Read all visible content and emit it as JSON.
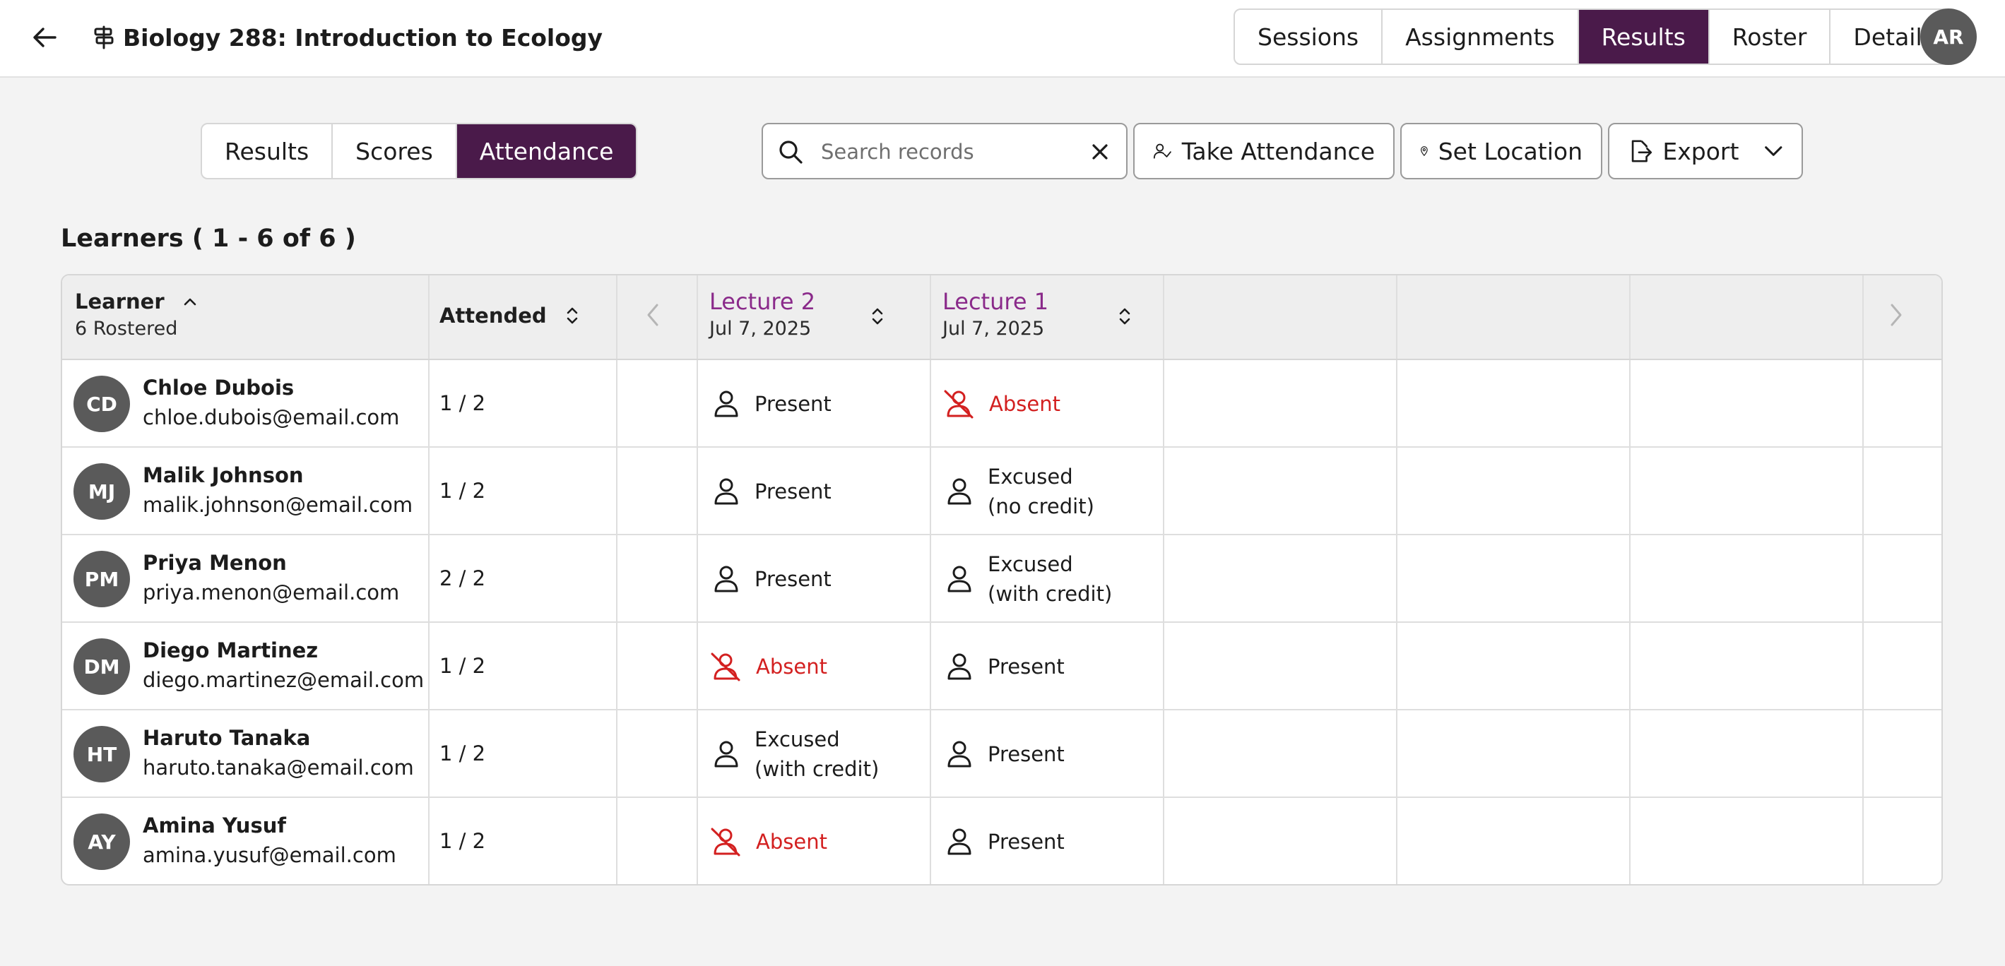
{
  "header": {
    "course_title": "Biology 288: Introduction to Ecology",
    "nav_tabs": [
      {
        "label": "Sessions",
        "active": false
      },
      {
        "label": "Assignments",
        "active": false
      },
      {
        "label": "Results",
        "active": true
      },
      {
        "label": "Roster",
        "active": false
      },
      {
        "label": "Details",
        "active": false
      }
    ],
    "user_initials": "AR"
  },
  "sub_tabs": [
    {
      "label": "Results",
      "active": false
    },
    {
      "label": "Scores",
      "active": false
    },
    {
      "label": "Attendance",
      "active": true
    }
  ],
  "toolbar": {
    "search_placeholder": "Search records",
    "search_value": "",
    "take_attendance_label": "Take Attendance",
    "set_location_label": "Set Location",
    "export_label": "Export"
  },
  "learners_heading": "Learners ( 1 - 6 of 6 )",
  "table": {
    "learner_header": "Learner",
    "rostered": "6 Rostered",
    "attended_header": "Attended",
    "sessions": [
      {
        "name": "Lecture 2",
        "date": "Jul 7, 2025"
      },
      {
        "name": "Lecture 1",
        "date": "Jul 7, 2025"
      }
    ],
    "rows": [
      {
        "initials": "CD",
        "name": "Chloe Dubois",
        "email": "chloe.dubois@email.com",
        "attended": "1 / 2",
        "statuses": [
          {
            "text": "Present",
            "type": "present"
          },
          {
            "text": "Absent",
            "type": "absent"
          }
        ]
      },
      {
        "initials": "MJ",
        "name": "Malik Johnson",
        "email": "malik.johnson@email.com",
        "attended": "1 / 2",
        "statuses": [
          {
            "text": "Present",
            "type": "present"
          },
          {
            "text": "Excused\n(no credit)",
            "type": "excused"
          }
        ]
      },
      {
        "initials": "PM",
        "name": "Priya Menon",
        "email": "priya.menon@email.com",
        "attended": "2 / 2",
        "statuses": [
          {
            "text": "Present",
            "type": "present"
          },
          {
            "text": "Excused\n(with credit)",
            "type": "excused"
          }
        ]
      },
      {
        "initials": "DM",
        "name": "Diego Martinez",
        "email": "diego.martinez@email.com",
        "attended": "1 / 2",
        "statuses": [
          {
            "text": "Absent",
            "type": "absent"
          },
          {
            "text": "Present",
            "type": "present"
          }
        ]
      },
      {
        "initials": "HT",
        "name": "Haruto Tanaka",
        "email": "haruto.tanaka@email.com",
        "attended": "1 / 2",
        "statuses": [
          {
            "text": "Excused\n(with credit)",
            "type": "excused"
          },
          {
            "text": "Present",
            "type": "present"
          }
        ]
      },
      {
        "initials": "AY",
        "name": "Amina Yusuf",
        "email": "amina.yusuf@email.com",
        "attended": "1 / 2",
        "statuses": [
          {
            "text": "Absent",
            "type": "absent"
          },
          {
            "text": "Present",
            "type": "present"
          }
        ]
      }
    ]
  },
  "colors": {
    "accent": "#4a1a4a",
    "session_link": "#8a2a8a",
    "absent": "#d32020",
    "avatar": "#5a5a5a"
  },
  "icons": {
    "back": "arrow-left-icon",
    "course": "signpost-icon",
    "search": "search-icon",
    "clear": "close-icon",
    "take_attendance": "user-check-icon",
    "set_location": "map-pin-icon",
    "export": "export-icon",
    "present": "person-icon",
    "absent": "person-slash-icon"
  }
}
